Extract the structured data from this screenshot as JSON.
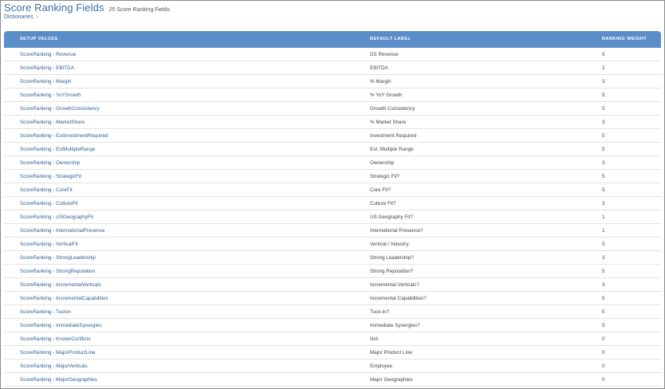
{
  "header": {
    "title": "Score Ranking Fields",
    "count": "25 Score Ranking Fields",
    "breadcrumb": "Dictionaries",
    "breadcrumb_chevron": "›"
  },
  "table": {
    "columns": [
      "SETUP VALUES",
      "DEFAULT LABEL",
      "RANKING WEIGHT"
    ],
    "rows": [
      {
        "setup": "ScoreRanking - Revenue",
        "label": "DS Revenue",
        "weight": "5"
      },
      {
        "setup": "ScoreRanking - EBITDA",
        "label": "EBITDA",
        "weight": "2"
      },
      {
        "setup": "ScoreRanking - Margin",
        "label": "% Margin",
        "weight": "3"
      },
      {
        "setup": "ScoreRanking - YoYGrowth",
        "label": "% YoY Growth",
        "weight": "5"
      },
      {
        "setup": "ScoreRanking - GrowthConsistency",
        "label": "Growth Consistency",
        "weight": "5"
      },
      {
        "setup": "ScoreRanking - MarketShare",
        "label": "% Market Share",
        "weight": "3"
      },
      {
        "setup": "ScoreRanking - EstInvestmentRequired",
        "label": "Investment Required",
        "weight": "5"
      },
      {
        "setup": "ScoreRanking - EstMultipleRange",
        "label": "Est. Multiple Range",
        "weight": "5"
      },
      {
        "setup": "ScoreRanking - Ownership",
        "label": "Ownership",
        "weight": "3"
      },
      {
        "setup": "ScoreRanking - StrategicFit",
        "label": "Strategic Fit?",
        "weight": "5"
      },
      {
        "setup": "ScoreRanking - CoreFit",
        "label": "Core Fit?",
        "weight": "5"
      },
      {
        "setup": "ScoreRanking - CultureFit",
        "label": "Culture Fit?",
        "weight": "3"
      },
      {
        "setup": "ScoreRanking - USGeographyFit",
        "label": "US Geography Fit?",
        "weight": "1"
      },
      {
        "setup": "ScoreRanking - InternationalPresence",
        "label": "International Presence?",
        "weight": "1"
      },
      {
        "setup": "ScoreRanking - VerticalFit",
        "label": "Vertical / Industry:",
        "weight": "5"
      },
      {
        "setup": "ScoreRanking - StrongLeadership",
        "label": "Strong Leadership?",
        "weight": "3"
      },
      {
        "setup": "ScoreRanking - StrongReputation",
        "label": "Strong Reputation?",
        "weight": "5"
      },
      {
        "setup": "ScoreRanking - IncrementalVerticals",
        "label": "Incremental Verticals?",
        "weight": "3"
      },
      {
        "setup": "ScoreRanking - IncrementalCapabilities",
        "label": "Incremental Capabilities?",
        "weight": "5"
      },
      {
        "setup": "ScoreRanking - TuckIn",
        "label": "Tuck-In?",
        "weight": "5"
      },
      {
        "setup": "ScoreRanking - ImmediateSynergies",
        "label": "Immediate Synergies?",
        "weight": "5"
      },
      {
        "setup": "ScoreRanking - KnownConflicts",
        "label": "N/A",
        "weight": "0"
      },
      {
        "setup": "ScoreRanking - MajorProductLine",
        "label": "Major Product Line",
        "weight": "0"
      },
      {
        "setup": "ScoreRanking - MajorVerticals",
        "label": "Employee",
        "weight": "0"
      },
      {
        "setup": "ScoreRanking - MajorGeographies",
        "label": "Major Geographies",
        "weight": "0"
      }
    ]
  }
}
